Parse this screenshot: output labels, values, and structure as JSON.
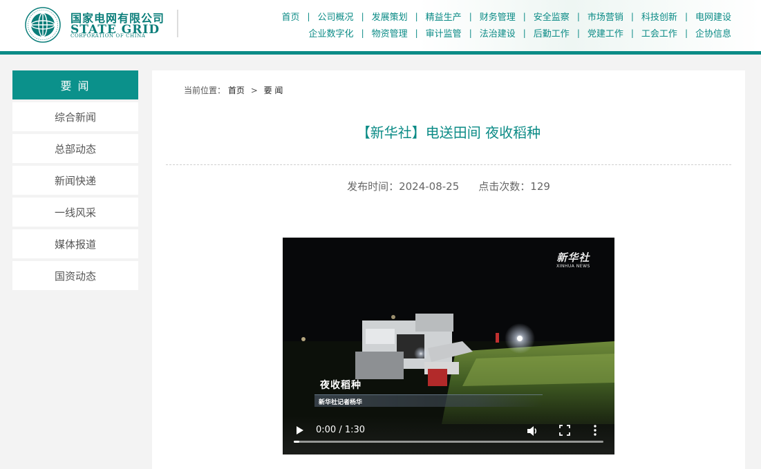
{
  "header": {
    "org_name_cn": "国家电网有限公司",
    "org_name_en": "STATE GRID",
    "org_name_en_sub": "CORPORATION OF CHINA",
    "nav_row1": [
      "首页",
      "公司概况",
      "发展策划",
      "精益生产",
      "财务管理",
      "安全监察",
      "市场营销",
      "科技创新",
      "电网建设"
    ],
    "nav_row2": [
      "企业数字化",
      "物资管理",
      "审计监管",
      "法治建设",
      "后勤工作",
      "党建工作",
      "工会工作",
      "企协信息"
    ],
    "separator": "|"
  },
  "sidebar": {
    "title": "要 闻",
    "items": [
      {
        "label": "综合新闻"
      },
      {
        "label": "总部动态"
      },
      {
        "label": "新闻快递"
      },
      {
        "label": "一线风采"
      },
      {
        "label": "媒体报道"
      },
      {
        "label": "国资动态"
      }
    ]
  },
  "breadcrumb": {
    "prefix": "当前位置：",
    "home": "首页",
    "sep": ">",
    "current": "要 闻"
  },
  "article": {
    "title": "【新华社】电送田间 夜收稻种",
    "publish_label": "发布时间：",
    "publish_date": "2024-08-25",
    "views_label": "点击次数：",
    "views": "129"
  },
  "video": {
    "watermark_cn": "新华社",
    "watermark_en": "XINHUA NEWS",
    "caption": "夜收稻种",
    "reporter": "新华社记者杨华",
    "time": "0:00 / 1:30",
    "progress": 0.0
  },
  "colors": {
    "brand": "#0b8b86",
    "sidebar_active": "#0b918b"
  }
}
